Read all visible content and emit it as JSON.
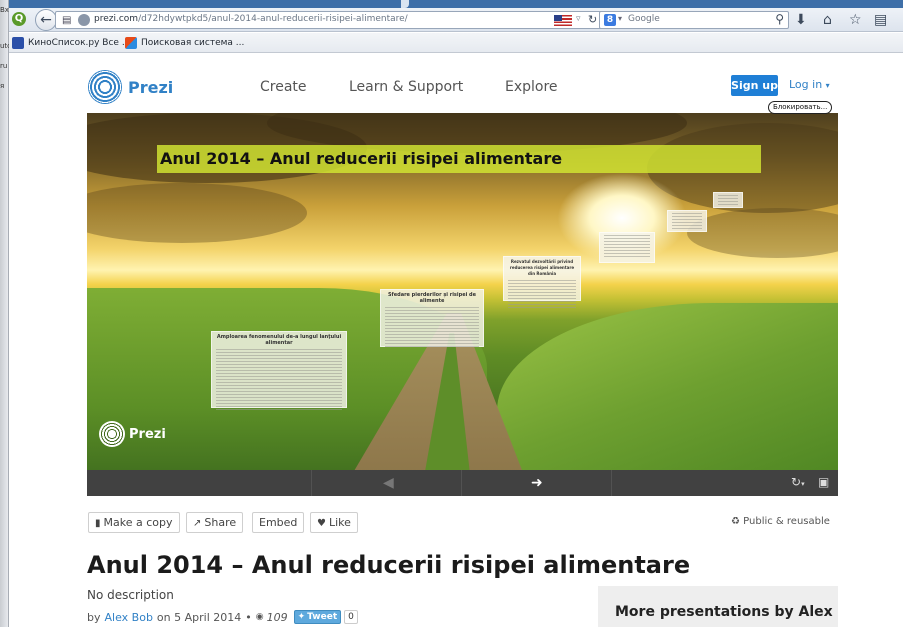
{
  "browser": {
    "url_domain": "prezi.com",
    "url_path": "/d72hdywtpkd5/anul-2014-anul-reducerii-risipei-alimentare/",
    "search_engine": "Google",
    "bookmarks": [
      {
        "label": "КиноСписок.ру Все ..."
      },
      {
        "label": "Поисковая система ..."
      }
    ],
    "left_strip_text": [
      "Вход",
      "utc",
      "ru",
      "я"
    ]
  },
  "header": {
    "logo": "Prezi",
    "nav": [
      "Create",
      "Learn & Support",
      "Explore"
    ],
    "signup_label": "Sign up",
    "login_label": "Log in",
    "block_label": "Блокировать..."
  },
  "viewer": {
    "slide_title": "Anul 2014 – Anul reducerii risipei alimentare",
    "notes": [
      {
        "title": "Amploarea fenomenului de-a lungul lanţului alimentar"
      },
      {
        "title": "Sfedare pierderilor și risipei de alimente"
      },
      {
        "title": "Rezvatul dezvoltării privind reducerea risipei alimentare din România"
      },
      {
        "title": ""
      },
      {
        "title": ""
      },
      {
        "title": ""
      }
    ],
    "logo_text": "Prezi"
  },
  "actions": {
    "make_copy": "Make a copy",
    "share": "Share",
    "embed": "Embed",
    "like": "Like",
    "public": "Public & reusable"
  },
  "presentation": {
    "title": "Anul 2014 – Anul reducerii risipei alimentare",
    "description": "No description",
    "by": "by",
    "author": "Alex Bob",
    "date_text": "on 5 April 2014",
    "views": "109",
    "tweet_label": "Tweet",
    "tweet_count": "0"
  },
  "sidebar": {
    "more_presentations": "More presentations by Alex"
  }
}
